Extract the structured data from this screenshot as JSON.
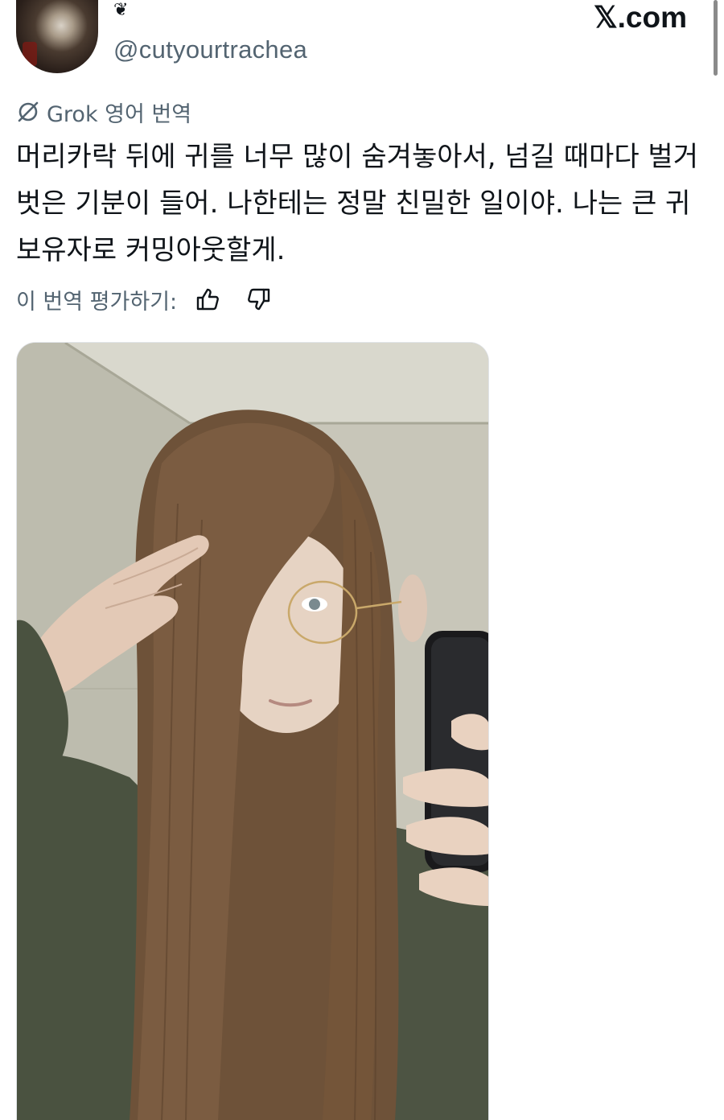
{
  "header": {
    "badge_icon": "❦",
    "handle": "@cutyourtrachea",
    "site_brand": "𝕏.com"
  },
  "translation": {
    "provider_icon": "grok-icon",
    "label": "Grok 영어 번역"
  },
  "tweet": {
    "text": "머리카락 뒤에 귀를 너무 많이 숨겨놓아서, 넘길 때마다 벌거벗은 기분이 들어. 나한테는 정말 친밀한 일이야. 나는 큰 귀 보유자로 커밍아웃할게."
  },
  "rating": {
    "prompt": "이 번역 평가하기:",
    "thumbs_up_icon": "thumbs-up-icon",
    "thumbs_down_icon": "thumbs-down-icon"
  },
  "media": {
    "kind": "photo",
    "description_icon": "mirror-selfie-photo"
  },
  "colors": {
    "text_primary": "#0f1419",
    "text_secondary": "#536471"
  }
}
